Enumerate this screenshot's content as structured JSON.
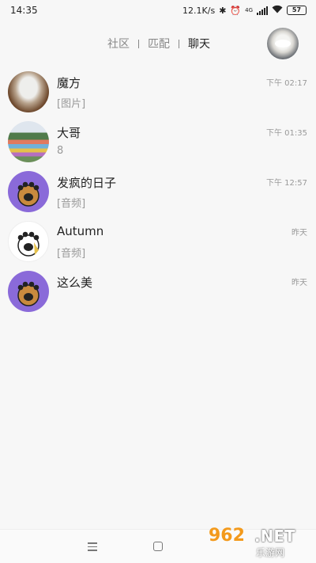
{
  "status_bar": {
    "time": "14:35",
    "speed": "12.1K/s",
    "network": "4G",
    "battery": "57"
  },
  "header": {
    "tabs": [
      {
        "label": "社区",
        "active": false
      },
      {
        "label": "匹配",
        "active": false
      },
      {
        "label": "聊天",
        "active": true
      }
    ]
  },
  "chats": [
    {
      "name": "魔方",
      "preview": "[图片]",
      "time": "下午 02:17",
      "avatar": "bowl-photo"
    },
    {
      "name": "大哥",
      "preview": "8",
      "time": "下午 01:35",
      "avatar": "rainbow-field-photo"
    },
    {
      "name": "发疯的日子",
      "preview": "[音频]",
      "time": "下午 12:57",
      "avatar": "cat-paw-purple"
    },
    {
      "name": "Autumn",
      "preview": "[音频]",
      "time": "昨天",
      "avatar": "cat-paw-white"
    },
    {
      "name": "这么美",
      "preview": "",
      "time": "昨天",
      "avatar": "cat-paw-purple"
    }
  ],
  "watermark": {
    "number": "962",
    "suffix": ".NET",
    "site": "乐游网"
  },
  "colors": {
    "accent_purple": "#8a6ad9",
    "watermark_orange": "#f39a1c"
  }
}
